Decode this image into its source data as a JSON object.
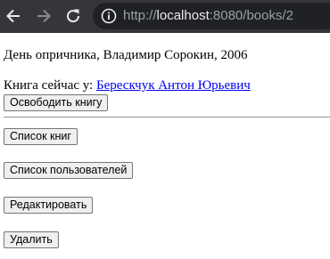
{
  "browser": {
    "url_scheme": "http://",
    "url_host": "localhost",
    "url_path": ":8080/books/2",
    "icons": {
      "back": "arrow-left-icon",
      "forward": "arrow-right-icon",
      "reload": "reload-icon",
      "info": "info-circle-icon"
    },
    "colors": {
      "toolbar": "#35363a",
      "omnibox": "#202124"
    }
  },
  "page": {
    "book_title": "День опричника, Владимир Сорокин, 2006",
    "holder_prefix": "Книга сейчас у: ",
    "holder_name": "Берескчук Антон Юрьевич",
    "release_button": "Освободить книгу",
    "books_list_button": "Список книг",
    "users_list_button": "Список пользователей",
    "edit_button": "Редактировать",
    "delete_button": "Удалить",
    "link_color": "#0000ee"
  }
}
